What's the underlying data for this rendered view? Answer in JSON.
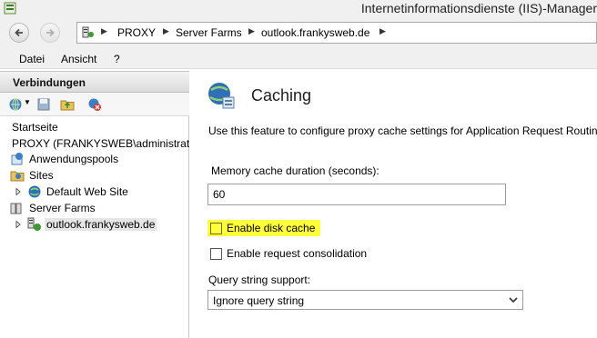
{
  "window": {
    "title": "Internetinformationsdienste (IIS)-Manager"
  },
  "address": {
    "crumbs": [
      "PROXY",
      "Server Farms",
      "outlook.frankysweb.de"
    ]
  },
  "menu": {
    "items": [
      "Datei",
      "Ansicht",
      "?"
    ]
  },
  "connections": {
    "title": "Verbindungen",
    "tree": {
      "start": "Startseite",
      "server": "PROXY (FRANKYSWEB\\administrator",
      "app_pools": "Anwendungspools",
      "sites": "Sites",
      "default_site": "Default Web Site",
      "server_farms": "Server Farms",
      "farm": "outlook.frankysweb.de"
    }
  },
  "feature": {
    "title": "Caching",
    "description": "Use this feature to configure proxy cache settings for Application Request Routing.",
    "memory_label": "Memory cache duration (seconds):",
    "memory_value": "60",
    "disk_cache_label": "Enable disk cache",
    "disk_cache_checked": false,
    "consolidation_label": "Enable request consolidation",
    "consolidation_checked": false,
    "query_label": "Query string support:",
    "query_value": "Ignore query string",
    "highlight_color": "#ffff3b"
  }
}
